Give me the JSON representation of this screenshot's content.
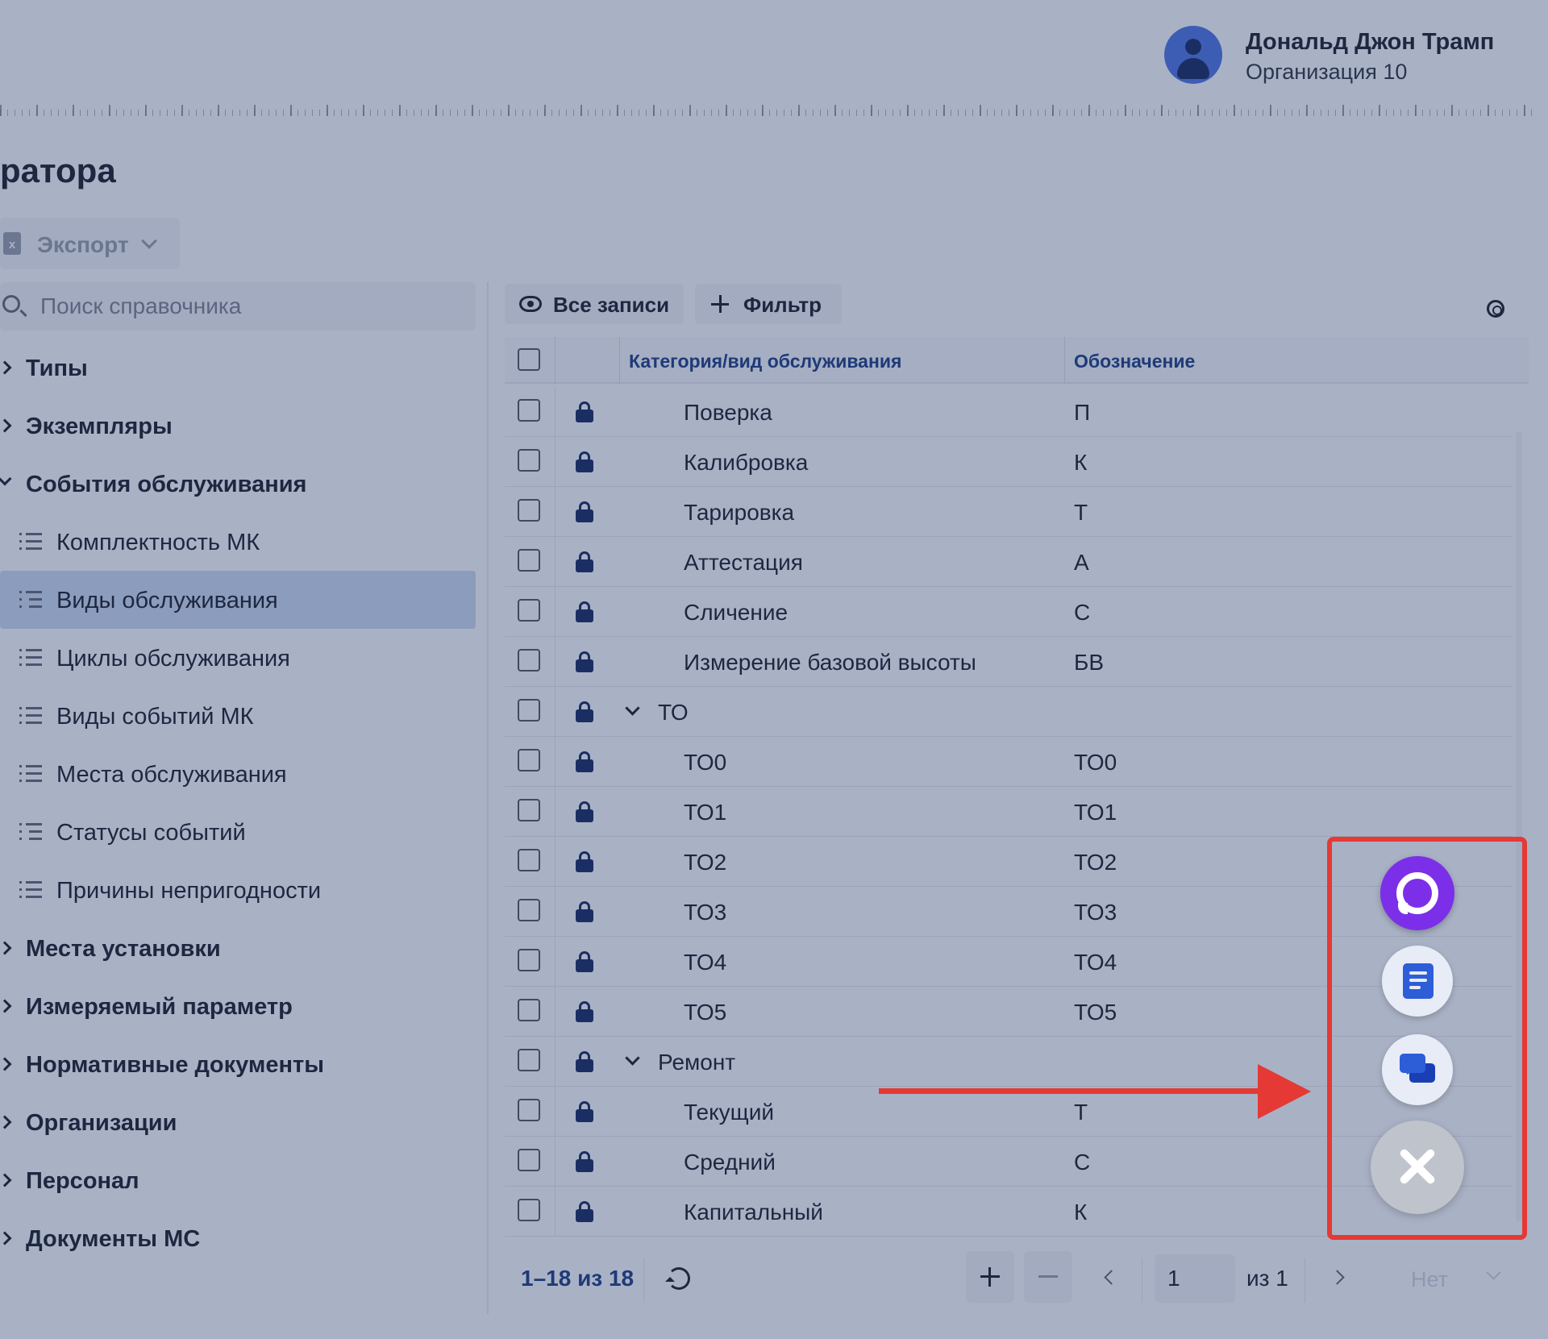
{
  "header": {
    "user_name": "Дональд Джон Трамп",
    "user_org": "Организация 10"
  },
  "page": {
    "title": "ратора"
  },
  "toolbar": {
    "export_label": "Экспорт",
    "export_icon": "x"
  },
  "sidebar": {
    "search_placeholder": "Поиск справочника",
    "items": [
      {
        "label": "Типы",
        "kind": "group",
        "expanded": false
      },
      {
        "label": "Экземпляры",
        "kind": "group",
        "expanded": false
      },
      {
        "label": "События обслуживания",
        "kind": "group",
        "expanded": true
      },
      {
        "label": "Комплектность МК",
        "kind": "child"
      },
      {
        "label": "Виды обслуживания",
        "kind": "child",
        "active": true
      },
      {
        "label": "Циклы обслуживания",
        "kind": "child"
      },
      {
        "label": "Виды событий МК",
        "kind": "child"
      },
      {
        "label": "Места обслуживания",
        "kind": "child"
      },
      {
        "label": "Статусы событий",
        "kind": "child"
      },
      {
        "label": "Причины непригодности",
        "kind": "child"
      },
      {
        "label": "Места установки",
        "kind": "group",
        "expanded": false
      },
      {
        "label": "Измеряемый параметр",
        "kind": "group",
        "expanded": false
      },
      {
        "label": "Нормативные документы",
        "kind": "group",
        "expanded": false
      },
      {
        "label": "Организации",
        "kind": "group",
        "expanded": false
      },
      {
        "label": "Персонал",
        "kind": "group",
        "expanded": false
      },
      {
        "label": "Документы МС",
        "kind": "group",
        "expanded": false
      }
    ]
  },
  "content": {
    "all_records_label": "Все записи",
    "filter_label": "Фильтр",
    "columns": [
      "Категория/вид обслуживания",
      "Обозначение"
    ],
    "rows": [
      {
        "name": "Поверка",
        "code": "П",
        "level": 1
      },
      {
        "name": "Калибровка",
        "code": "К",
        "level": 1
      },
      {
        "name": "Тарировка",
        "code": "Т",
        "level": 1
      },
      {
        "name": "Аттестация",
        "code": "А",
        "level": 1
      },
      {
        "name": "Сличение",
        "code": "С",
        "level": 1
      },
      {
        "name": "Измерение базовой высоты",
        "code": "БВ",
        "level": 1
      },
      {
        "name": "ТО",
        "code": "",
        "level": 0,
        "expanded": true
      },
      {
        "name": "ТО0",
        "code": "ТО0",
        "level": 1
      },
      {
        "name": "ТО1",
        "code": "ТО1",
        "level": 1
      },
      {
        "name": "ТО2",
        "code": "ТО2",
        "level": 1
      },
      {
        "name": "ТО3",
        "code": "ТО3",
        "level": 1
      },
      {
        "name": "ТО4",
        "code": "ТО4",
        "level": 1
      },
      {
        "name": "ТО5",
        "code": "ТО5",
        "level": 1
      },
      {
        "name": "Ремонт",
        "code": "",
        "level": 0,
        "expanded": true
      },
      {
        "name": "Текущий",
        "code": "Т",
        "level": 1
      },
      {
        "name": "Средний",
        "code": "С",
        "level": 1
      },
      {
        "name": "Капитальный",
        "code": "К",
        "level": 1
      }
    ]
  },
  "pager": {
    "range": "1–18 из 18",
    "page": "1",
    "of_total": "из 1",
    "select_value": "Нет"
  },
  "colors": {
    "callout": "#e53935",
    "max_app": "#7c2fe8",
    "accent": "#2d5ed8"
  }
}
